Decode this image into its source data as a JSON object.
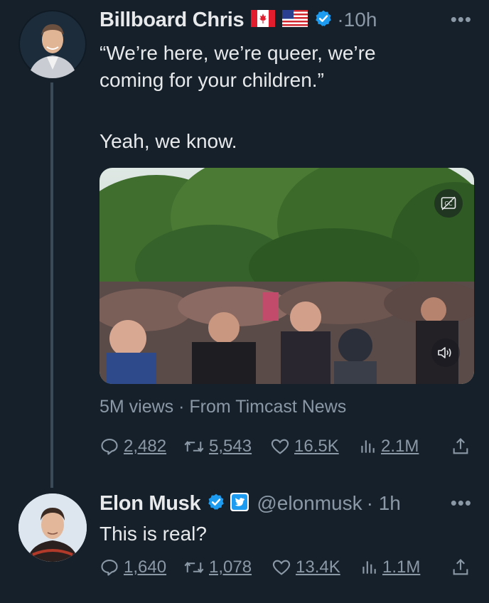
{
  "tweet1": {
    "author_name": "Billboard Chris",
    "flags": [
      "canada-flag",
      "usa-flag"
    ],
    "time": "·10h",
    "text_line1": "“We’re here, we’re queer, we’re",
    "text_line2": "coming for your children.”",
    "text_line3": "Yeah, we know.",
    "media_type": "video",
    "views_text": "5M views · From Timcast News",
    "replies": "2,482",
    "reposts": "5,543",
    "likes": "16.5K",
    "views": "2.1M"
  },
  "tweet2": {
    "author_name": "Elon Musk",
    "handle": "@elonmusk",
    "time": "· 1h",
    "text": "This is real?",
    "replies": "1,640",
    "reposts": "1,078",
    "likes": "13.4K",
    "views": "1.1M"
  },
  "more_label": "•••",
  "colors": {
    "background": "#15202b",
    "text": "#e7e9ea",
    "secondary": "#8b98a5",
    "verified": "#1d9bf0"
  }
}
